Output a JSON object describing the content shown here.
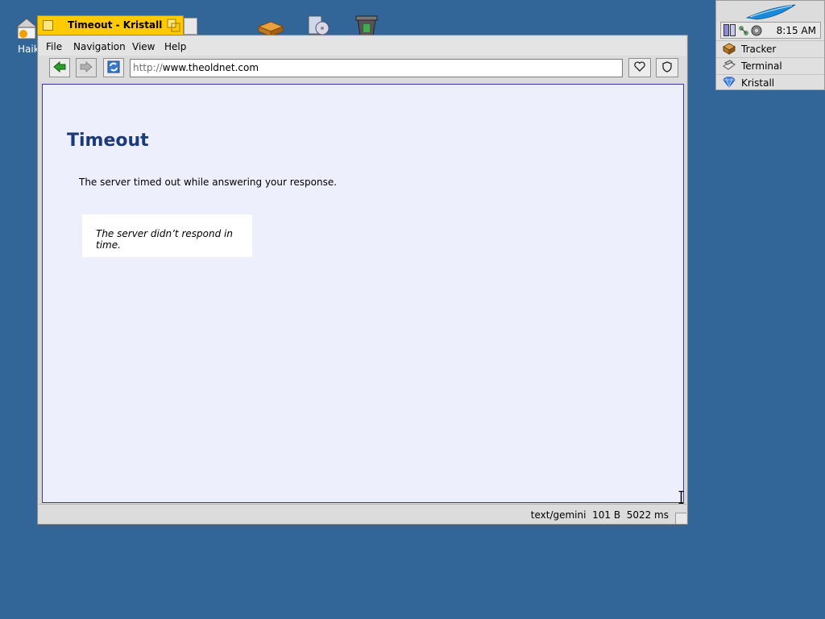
{
  "desktop": {
    "icons": [
      {
        "name": "home-icon",
        "label": "Haik"
      },
      {
        "name": "package-icon"
      },
      {
        "name": "media-icon"
      },
      {
        "name": "trash-icon"
      }
    ]
  },
  "window": {
    "tab_title": "Timeout - Kristall",
    "menu": [
      "File",
      "Navigation",
      "View",
      "Help"
    ],
    "toolbar": {
      "url_protocol": "http://",
      "url_host": "www.theoldnet.com",
      "back_icon": "arrow-left-icon",
      "forward_icon": "arrow-right-icon",
      "reload_icon": "reload-icon",
      "favorite_icon": "heart-icon",
      "identity_icon": "shield-icon"
    },
    "page": {
      "heading": "Timeout",
      "message": "The server timed out while answering your response.",
      "quote": "The server didn’t respond in time."
    },
    "status": {
      "mime": "text/gemini",
      "size": "101 B",
      "time": "5022 ms"
    }
  },
  "deskbar": {
    "clock": "8:15 AM",
    "apps": [
      {
        "label": "Tracker",
        "icon": "tracker-icon"
      },
      {
        "label": "Terminal",
        "icon": "terminal-icon"
      },
      {
        "label": "Kristall",
        "icon": "kristall-gem-icon"
      }
    ]
  },
  "colors": {
    "desktop": "#336698",
    "tab": "#ffcb00",
    "page_background": "#eeeffd",
    "heading": "#1a3a7a",
    "back_arrow": "#2aa02a"
  }
}
